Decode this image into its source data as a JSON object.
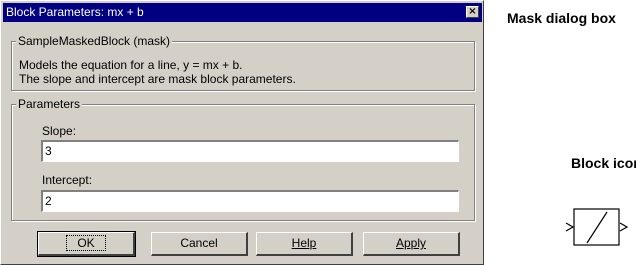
{
  "dialog": {
    "title": "Block Parameters: mx + b",
    "close_glyph": "×",
    "mask_group": {
      "legend": "SampleMaskedBlock (mask)",
      "line1": "Models the equation for a line, y = mx + b.",
      "line2": "The slope and intercept are mask block parameters."
    },
    "params_group": {
      "legend": "Parameters",
      "slope_label": "Slope:",
      "slope_value": "3",
      "intercept_label": "Intercept:",
      "intercept_value": "2"
    },
    "buttons": {
      "ok": "OK",
      "cancel": "Cancel",
      "help": "Help",
      "apply": "Apply"
    }
  },
  "annotations": {
    "mask_dialog_box": "Mask dialog box",
    "block_icon": "Block icon"
  },
  "icons": {
    "close": "close-icon",
    "block": "masked-block-icon"
  }
}
